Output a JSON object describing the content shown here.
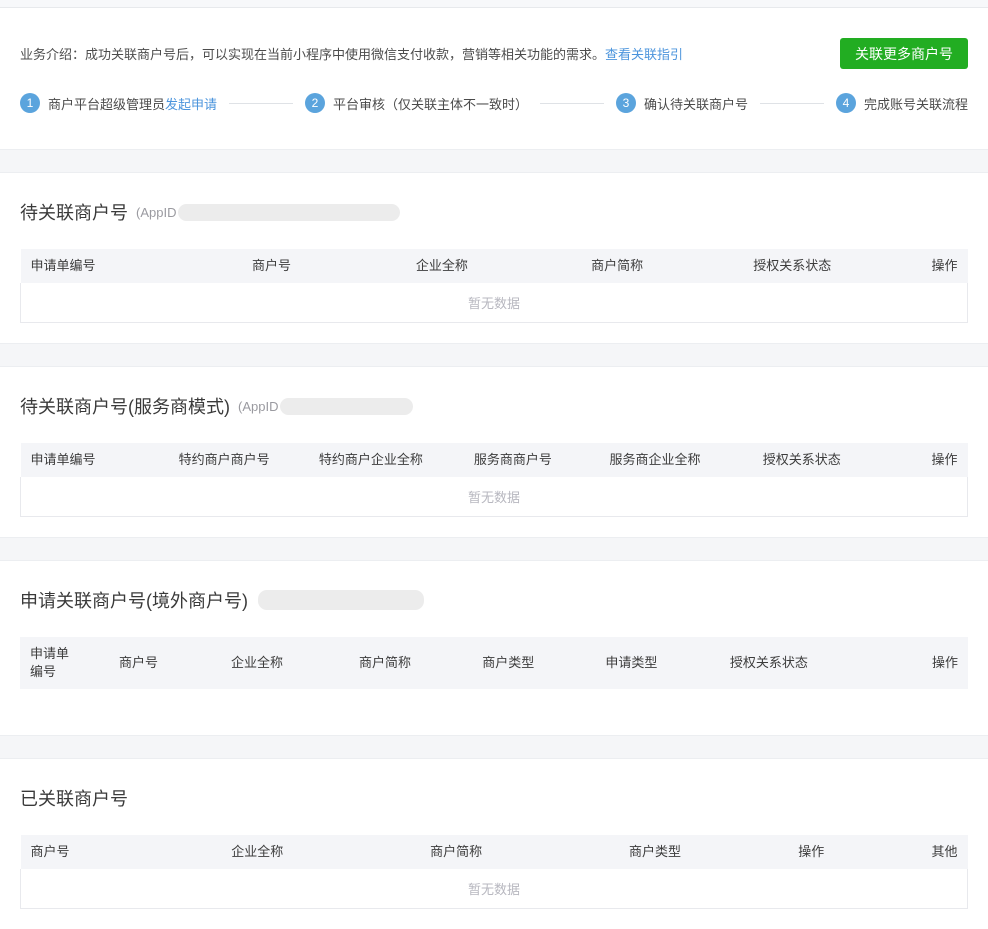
{
  "intro": {
    "text": "业务介绍：成功关联商户号后，可以实现在当前小程序中使用微信支付收款，营销等相关功能的需求。",
    "link": "查看关联指引",
    "button": "关联更多商户号"
  },
  "colors": {
    "accent_green": "#22ad22",
    "link_blue": "#4b94dc",
    "step_blue": "#5ba4dd"
  },
  "steps": [
    {
      "num": "1",
      "label": "商户平台超级管理员",
      "link": "发起申请"
    },
    {
      "num": "2",
      "label": "平台审核（仅关联主体不一致时）",
      "link": ""
    },
    {
      "num": "3",
      "label": "确认待关联商户号",
      "link": ""
    },
    {
      "num": "4",
      "label": "完成账号关联流程",
      "link": ""
    }
  ],
  "sections": [
    {
      "title": "待关联商户号",
      "subtitle": "(AppID",
      "columns": [
        "申请单编号",
        "商户号",
        "企业全称",
        "商户简称",
        "授权关系状态",
        "操作"
      ],
      "empty_text": "暂无数据"
    },
    {
      "title": "待关联商户号(服务商模式)",
      "subtitle": "(AppID",
      "columns": [
        "申请单编号",
        "特约商户商户号",
        "特约商户企业全称",
        "服务商商户号",
        "服务商企业全称",
        "授权关系状态",
        "操作"
      ],
      "empty_text": "暂无数据"
    },
    {
      "title": "申请关联商户号(境外商户号)",
      "subtitle": "",
      "columns": [
        "申请单编号",
        "商户号",
        "企业全称",
        "商户简称",
        "商户类型",
        "申请类型",
        "授权关系状态",
        "操作"
      ],
      "empty_text": ""
    },
    {
      "title": "已关联商户号",
      "subtitle": "",
      "columns": [
        "商户号",
        "企业全称",
        "商户简称",
        "商户类型",
        "操作",
        "其他"
      ],
      "empty_text": "暂无数据"
    }
  ]
}
